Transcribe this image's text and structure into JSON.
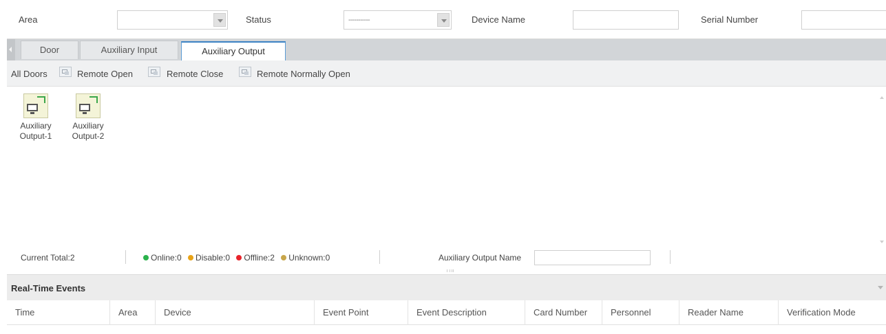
{
  "filters": {
    "area_label": "Area",
    "area_value": "",
    "status_label": "Status",
    "status_value": "-----------",
    "device_name_label": "Device Name",
    "device_name_value": "",
    "serial_number_label": "Serial Number",
    "serial_number_value": ""
  },
  "tabs": [
    {
      "label": "Door",
      "active": false
    },
    {
      "label": "Auxiliary Input",
      "active": false
    },
    {
      "label": "Auxiliary Output",
      "active": true
    }
  ],
  "toolbar": {
    "all_doors": "All Doors",
    "remote_open": "Remote Open",
    "remote_close": "Remote Close",
    "remote_normally_open": "Remote Normally Open",
    "icon": "door-remote-icon"
  },
  "devices": [
    {
      "line1": "Auxiliary",
      "line2": "Output-1",
      "icon": "auxiliary-output-icon"
    },
    {
      "line1": "Auxiliary",
      "line2": "Output-2",
      "icon": "auxiliary-output-icon"
    }
  ],
  "status": {
    "current_total": "Current Total:2",
    "online": "Online:0",
    "disable": "Disable:0",
    "offline": "Offline:2",
    "unknown": "Unknown:0",
    "output_name_label": "Auxiliary Output Name",
    "output_name_value": "",
    "colors": {
      "online": "#2bb24c",
      "disable": "#e8a317",
      "offline": "#e8242b",
      "unknown": "#c8a64b"
    }
  },
  "events": {
    "title": "Real-Time Events",
    "columns": [
      "Time",
      "Area",
      "Device",
      "Event Point",
      "Event Description",
      "Card Number",
      "Personnel",
      "Reader Name",
      "Verification Mode"
    ]
  },
  "theme": {
    "active_tab_border": "#3b82c4",
    "tab_bar_bg": "#d2d5d8"
  }
}
